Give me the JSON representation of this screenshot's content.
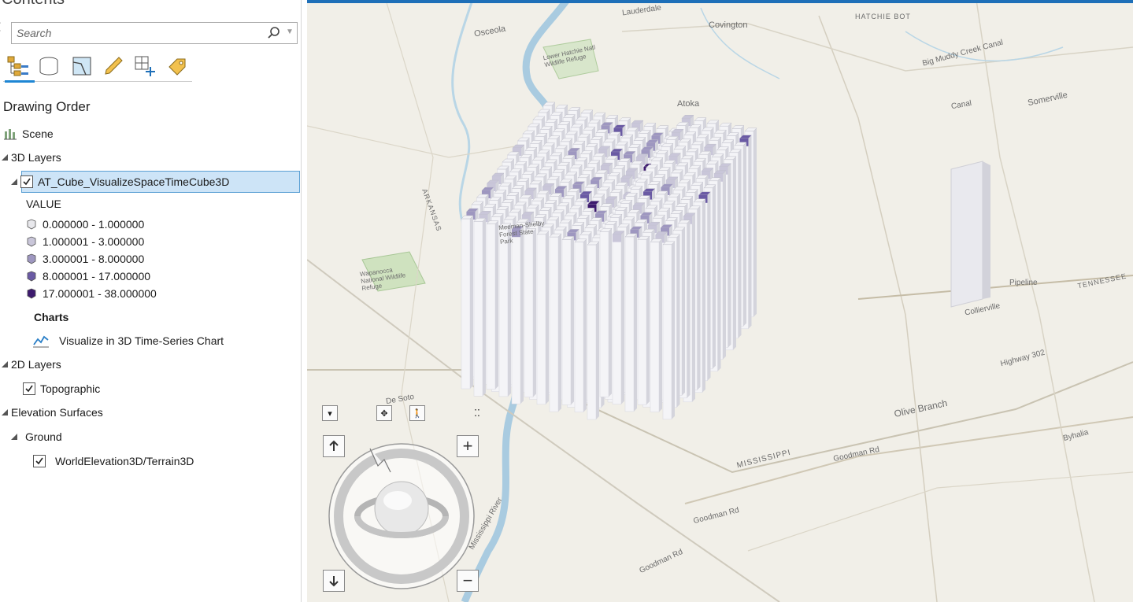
{
  "pane": {
    "title": "Contents",
    "search_placeholder": "Search",
    "heading": "Drawing Order",
    "toolbar": [
      {
        "name": "list-by-drawing-order-icon"
      },
      {
        "name": "list-by-data-source-icon"
      },
      {
        "name": "list-by-selection-icon"
      },
      {
        "name": "list-by-editing-icon"
      },
      {
        "name": "list-by-snapping-icon"
      },
      {
        "name": "list-by-labeling-icon"
      }
    ]
  },
  "tree": {
    "scene": "Scene",
    "layers3d": "3D Layers",
    "cube_layer": "AT_Cube_VisualizeSpaceTimeCube3D",
    "value_label": "VALUE",
    "legend": [
      {
        "label": "0.000000 - 1.000000",
        "color": "#e8e8ec"
      },
      {
        "label": "1.000001 - 3.000000",
        "color": "#c9c6d9"
      },
      {
        "label": "3.000001 - 8.000000",
        "color": "#9e97c0"
      },
      {
        "label": "8.000001 - 17.000000",
        "color": "#6a5aa4"
      },
      {
        "label": "17.000001 - 38.000000",
        "color": "#3d1a6e"
      }
    ],
    "charts_label": "Charts",
    "chart_item": "Visualize in 3D Time-Series Chart",
    "layers2d": "2D Layers",
    "topo": "Topographic",
    "elev": "Elevation Surfaces",
    "ground": "Ground",
    "terrain": "WorldElevation3D/Terrain3D"
  },
  "map": {
    "labels": {
      "lauderdale": "Lauderdale",
      "covington": "Covington",
      "osceola": "Osceola",
      "atoka": "Atoka",
      "somerville": "Somerville",
      "collierville": "Collierville",
      "olive_branch": "Olive Branch",
      "mississippi": "MISSISSIPPI",
      "tennessee": "TENNESSEE",
      "arkansas": "ARKANSAS",
      "goodman_rd": "Goodman Rd",
      "hatchie": "HATCHIE BOT",
      "highway": "Highway 302",
      "byhalia": "Byhalia",
      "pipeline": "Pipeline",
      "wapanocca": "Wapanocca National Wildlife Refuge",
      "meeman": "Meeman-Shelby Forest State Park",
      "lower_hatchie": "Lower Hatchie Natl Wildlife Refuge",
      "de_soto": "De Soto",
      "big_creek": "Big Muddy Creek Canal",
      "canal": "Canal",
      "river_label": "Mississippi River"
    },
    "cube_colors": {
      "base": "#f2f2f5",
      "side": "#d4d4dc",
      "light": "#c9c6d9",
      "mid": "#9e97c0",
      "dark": "#6a5aa4",
      "darkest": "#3d1a6e"
    },
    "navigator": {
      "up": "up-arrow-icon",
      "down": "down-arrow-icon",
      "zoom_in": "+",
      "zoom_out": "−"
    }
  }
}
